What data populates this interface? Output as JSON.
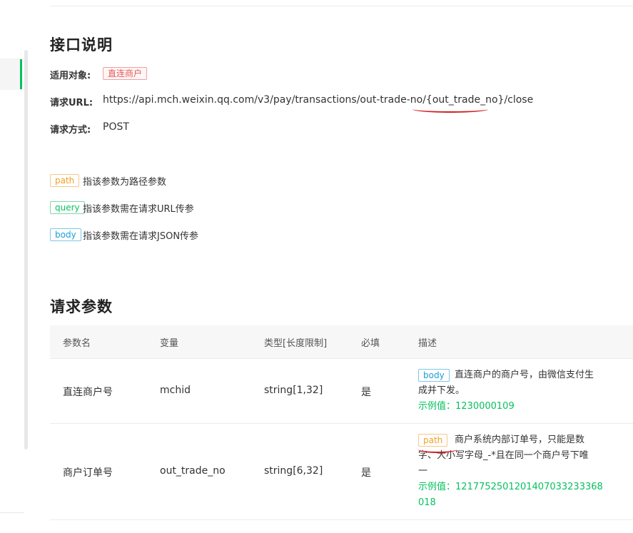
{
  "section1": {
    "title": "接口说明",
    "applicable_label": "适用对象:",
    "applicable_tag": "直连商户",
    "url_label": "请求URL:",
    "url_prefix": "https://api.mch.weixin.qq.com/v3/pay/transactions/out-trade-no/",
    "url_param": "{out_trade_no}",
    "url_suffix": "/close",
    "method_label": "请求方式:",
    "method_value": "POST"
  },
  "legend": [
    {
      "tag": "path",
      "text": "指该参数为路径参数"
    },
    {
      "tag": "query",
      "text": "指该参数需在请求URL传参"
    },
    {
      "tag": "body",
      "text": "指该参数需在请求JSON传参"
    }
  ],
  "section2": {
    "title": "请求参数"
  },
  "table": {
    "headers": [
      "参数名",
      "变量",
      "类型[长度限制]",
      "必填",
      "描述"
    ],
    "rows": [
      {
        "name": "直连商户号",
        "variable": "mchid",
        "type": "string[1,32]",
        "required": "是",
        "tag": "body",
        "desc_line1": "直连商户的商户号，由微信支付生",
        "desc_line2": "成并下发。",
        "example": "示例值：1230000109"
      },
      {
        "name": "商户订单号",
        "variable": "out_trade_no",
        "type": "string[6,32]",
        "required": "是",
        "tag": "path",
        "desc_line1": "商户系统内部订单号，只能是数",
        "desc_line2": "字、大小写字母_-*且在同一个商户号下唯",
        "desc_line3": "一",
        "example_line1": "示例值：1217752501201407033233368",
        "example_line2": "018"
      }
    ]
  },
  "colors": {
    "accent_green": "#07c160",
    "annotation_red": "#d32020"
  }
}
